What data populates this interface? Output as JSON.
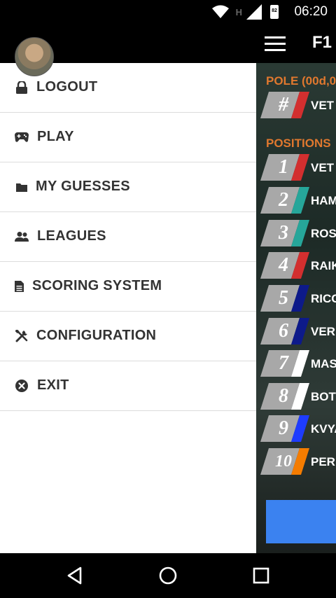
{
  "status_bar": {
    "time": "06:20",
    "battery": "82",
    "network_label": "H"
  },
  "app_bar": {
    "title": "F1"
  },
  "drawer": {
    "items": [
      {
        "label": "LOGOUT",
        "icon": "lock-icon"
      },
      {
        "label": "PLAY",
        "icon": "gamepad-icon"
      },
      {
        "label": "MY GUESSES",
        "icon": "folder-icon"
      },
      {
        "label": "LEAGUES",
        "icon": "users-icon"
      },
      {
        "label": "SCORING SYSTEM",
        "icon": "document-icon"
      },
      {
        "label": "CONFIGURATION",
        "icon": "tools-icon"
      },
      {
        "label": "EXIT",
        "icon": "close-circle-icon"
      }
    ]
  },
  "content": {
    "pole_label": "POLE (00d,0",
    "pole": {
      "badge": "#",
      "driver": "VET",
      "color": "#d32f2f"
    },
    "positions_label": "POSITIONS",
    "positions": [
      {
        "badge": "1",
        "driver": "VET",
        "color": "#d32f2f"
      },
      {
        "badge": "2",
        "driver": "HAM",
        "color": "#26a69a"
      },
      {
        "badge": "3",
        "driver": "ROS",
        "color": "#26a69a"
      },
      {
        "badge": "4",
        "driver": "RAIK",
        "color": "#d32f2f"
      },
      {
        "badge": "5",
        "driver": "RICC",
        "color": "#0d1a8a"
      },
      {
        "badge": "6",
        "driver": "VER",
        "color": "#0d1a8a"
      },
      {
        "badge": "7",
        "driver": "MAS",
        "color": "#ffffff"
      },
      {
        "badge": "8",
        "driver": "BOT",
        "color": "#ffffff"
      },
      {
        "badge": "9",
        "driver": "KVYA",
        "color": "#1e3cff"
      },
      {
        "badge": "10",
        "driver": "PER",
        "color": "#f57c00"
      }
    ]
  },
  "colors": {
    "accent_orange": "#e0782e",
    "button_blue": "#3b82f0"
  }
}
